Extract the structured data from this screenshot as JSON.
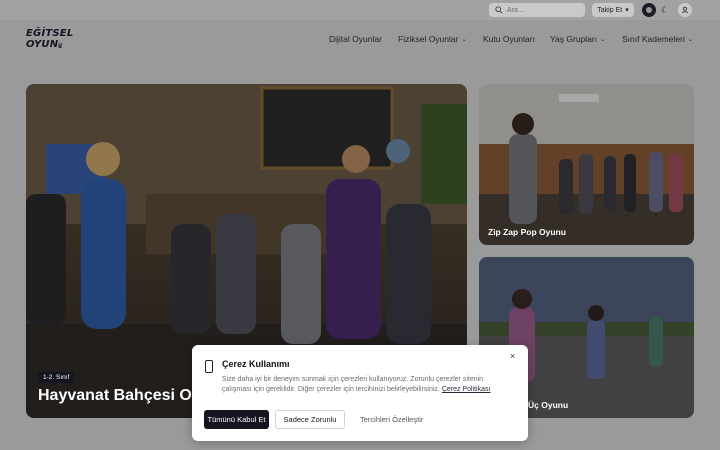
{
  "topbar": {
    "search_placeholder": "Ara...",
    "follow_label": "Takip Et",
    "follow_chevron": "▾",
    "theme_moon_glyph": "☾"
  },
  "logo": {
    "line1": "EĞİTSEL",
    "line2": "OYUN",
    "crown": "♛"
  },
  "nav": {
    "items": [
      {
        "label": "Dijital Oyunlar",
        "has_dropdown": false
      },
      {
        "label": "Fiziksel Oyunlar",
        "has_dropdown": true
      },
      {
        "label": "Kutu Oyunları",
        "has_dropdown": false
      },
      {
        "label": "Yaş Grupları",
        "has_dropdown": true
      },
      {
        "label": "Sınıf Kademeleri",
        "has_dropdown": true
      }
    ],
    "chevron": "⌄"
  },
  "cards": {
    "featured": {
      "badge": "1-2. Sınıf",
      "title": "Hayvanat Bahçesi Oy"
    },
    "second": {
      "title": "Zip Zap Pop Oyunu"
    },
    "third": {
      "title": "Üç Oyunu"
    }
  },
  "cookie": {
    "title": "Çerez Kullanımı",
    "text": "Size daha iyi bir deneyim sunmak için çerezleri kullanıyoruz. Zorunlu çerezler sitenin çalışması için gereklidir. Diğer çerezler için tercihinizi belirleyebilirsiniz.",
    "policy_link": "Çerez Politikası",
    "accept_all": "Tümünü Kabul Et",
    "only_required": "Sadece Zorunlu",
    "customize": "Tercihleri Özelleştir",
    "close_glyph": "×"
  },
  "colors": {
    "dark": "#151520",
    "overlay": "#9a9a9a",
    "white": "#ffffff"
  }
}
